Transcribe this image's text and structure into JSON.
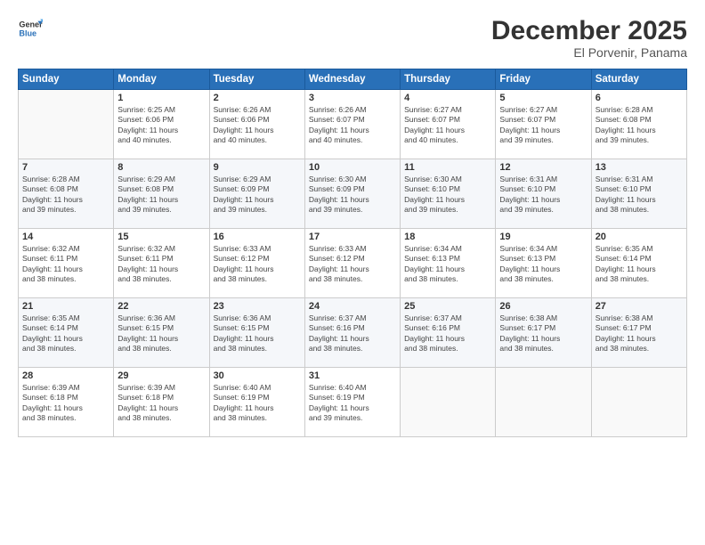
{
  "header": {
    "logo_line1": "General",
    "logo_line2": "Blue",
    "title": "December 2025",
    "subtitle": "El Porvenir, Panama"
  },
  "calendar": {
    "days_of_week": [
      "Sunday",
      "Monday",
      "Tuesday",
      "Wednesday",
      "Thursday",
      "Friday",
      "Saturday"
    ],
    "weeks": [
      [
        {
          "day": "",
          "info": ""
        },
        {
          "day": "1",
          "info": "Sunrise: 6:25 AM\nSunset: 6:06 PM\nDaylight: 11 hours\nand 40 minutes."
        },
        {
          "day": "2",
          "info": "Sunrise: 6:26 AM\nSunset: 6:06 PM\nDaylight: 11 hours\nand 40 minutes."
        },
        {
          "day": "3",
          "info": "Sunrise: 6:26 AM\nSunset: 6:07 PM\nDaylight: 11 hours\nand 40 minutes."
        },
        {
          "day": "4",
          "info": "Sunrise: 6:27 AM\nSunset: 6:07 PM\nDaylight: 11 hours\nand 40 minutes."
        },
        {
          "day": "5",
          "info": "Sunrise: 6:27 AM\nSunset: 6:07 PM\nDaylight: 11 hours\nand 39 minutes."
        },
        {
          "day": "6",
          "info": "Sunrise: 6:28 AM\nSunset: 6:08 PM\nDaylight: 11 hours\nand 39 minutes."
        }
      ],
      [
        {
          "day": "7",
          "info": "Sunrise: 6:28 AM\nSunset: 6:08 PM\nDaylight: 11 hours\nand 39 minutes."
        },
        {
          "day": "8",
          "info": "Sunrise: 6:29 AM\nSunset: 6:08 PM\nDaylight: 11 hours\nand 39 minutes."
        },
        {
          "day": "9",
          "info": "Sunrise: 6:29 AM\nSunset: 6:09 PM\nDaylight: 11 hours\nand 39 minutes."
        },
        {
          "day": "10",
          "info": "Sunrise: 6:30 AM\nSunset: 6:09 PM\nDaylight: 11 hours\nand 39 minutes."
        },
        {
          "day": "11",
          "info": "Sunrise: 6:30 AM\nSunset: 6:10 PM\nDaylight: 11 hours\nand 39 minutes."
        },
        {
          "day": "12",
          "info": "Sunrise: 6:31 AM\nSunset: 6:10 PM\nDaylight: 11 hours\nand 39 minutes."
        },
        {
          "day": "13",
          "info": "Sunrise: 6:31 AM\nSunset: 6:10 PM\nDaylight: 11 hours\nand 38 minutes."
        }
      ],
      [
        {
          "day": "14",
          "info": "Sunrise: 6:32 AM\nSunset: 6:11 PM\nDaylight: 11 hours\nand 38 minutes."
        },
        {
          "day": "15",
          "info": "Sunrise: 6:32 AM\nSunset: 6:11 PM\nDaylight: 11 hours\nand 38 minutes."
        },
        {
          "day": "16",
          "info": "Sunrise: 6:33 AM\nSunset: 6:12 PM\nDaylight: 11 hours\nand 38 minutes."
        },
        {
          "day": "17",
          "info": "Sunrise: 6:33 AM\nSunset: 6:12 PM\nDaylight: 11 hours\nand 38 minutes."
        },
        {
          "day": "18",
          "info": "Sunrise: 6:34 AM\nSunset: 6:13 PM\nDaylight: 11 hours\nand 38 minutes."
        },
        {
          "day": "19",
          "info": "Sunrise: 6:34 AM\nSunset: 6:13 PM\nDaylight: 11 hours\nand 38 minutes."
        },
        {
          "day": "20",
          "info": "Sunrise: 6:35 AM\nSunset: 6:14 PM\nDaylight: 11 hours\nand 38 minutes."
        }
      ],
      [
        {
          "day": "21",
          "info": "Sunrise: 6:35 AM\nSunset: 6:14 PM\nDaylight: 11 hours\nand 38 minutes."
        },
        {
          "day": "22",
          "info": "Sunrise: 6:36 AM\nSunset: 6:15 PM\nDaylight: 11 hours\nand 38 minutes."
        },
        {
          "day": "23",
          "info": "Sunrise: 6:36 AM\nSunset: 6:15 PM\nDaylight: 11 hours\nand 38 minutes."
        },
        {
          "day": "24",
          "info": "Sunrise: 6:37 AM\nSunset: 6:16 PM\nDaylight: 11 hours\nand 38 minutes."
        },
        {
          "day": "25",
          "info": "Sunrise: 6:37 AM\nSunset: 6:16 PM\nDaylight: 11 hours\nand 38 minutes."
        },
        {
          "day": "26",
          "info": "Sunrise: 6:38 AM\nSunset: 6:17 PM\nDaylight: 11 hours\nand 38 minutes."
        },
        {
          "day": "27",
          "info": "Sunrise: 6:38 AM\nSunset: 6:17 PM\nDaylight: 11 hours\nand 38 minutes."
        }
      ],
      [
        {
          "day": "28",
          "info": "Sunrise: 6:39 AM\nSunset: 6:18 PM\nDaylight: 11 hours\nand 38 minutes."
        },
        {
          "day": "29",
          "info": "Sunrise: 6:39 AM\nSunset: 6:18 PM\nDaylight: 11 hours\nand 38 minutes."
        },
        {
          "day": "30",
          "info": "Sunrise: 6:40 AM\nSunset: 6:19 PM\nDaylight: 11 hours\nand 38 minutes."
        },
        {
          "day": "31",
          "info": "Sunrise: 6:40 AM\nSunset: 6:19 PM\nDaylight: 11 hours\nand 39 minutes."
        },
        {
          "day": "",
          "info": ""
        },
        {
          "day": "",
          "info": ""
        },
        {
          "day": "",
          "info": ""
        }
      ]
    ]
  }
}
